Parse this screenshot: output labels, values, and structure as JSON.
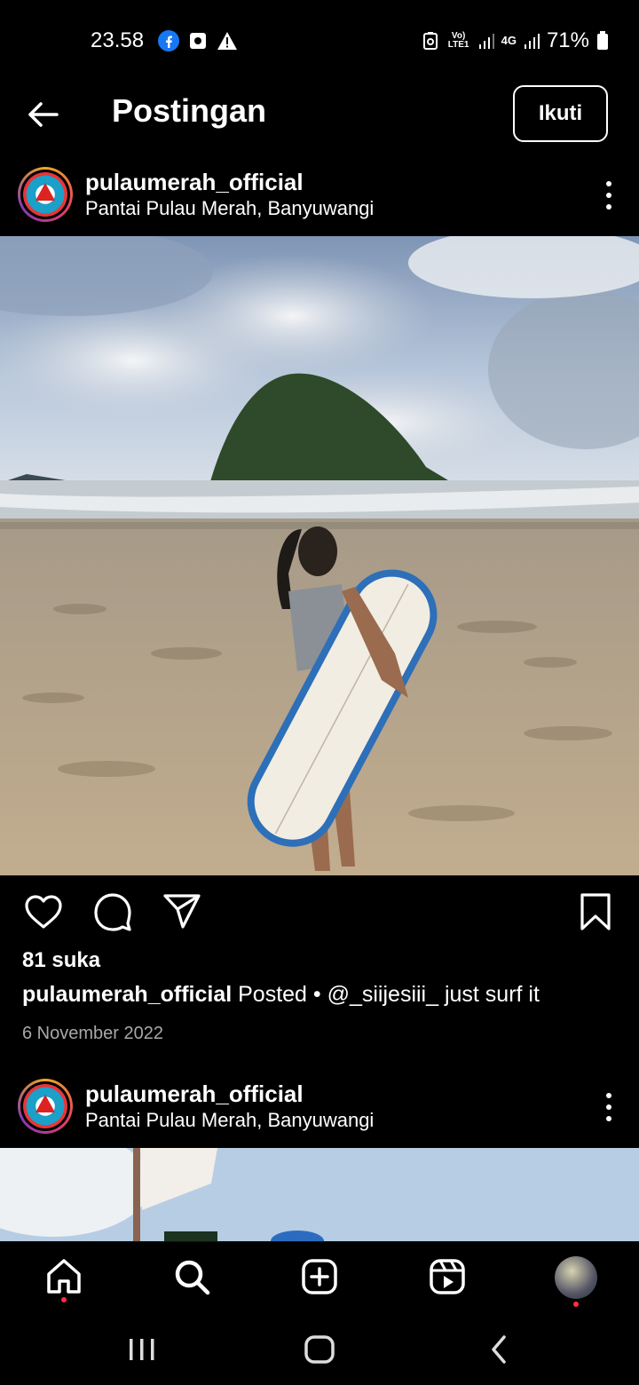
{
  "status_bar": {
    "time": "23.58",
    "battery": "71%",
    "volte_label": "Vo) LTE1",
    "network_label": "4G",
    "icons": [
      "facebook-icon",
      "screenshot-icon",
      "warning-icon",
      "recycle-icon",
      "signal-icon",
      "signal-icon",
      "battery-icon"
    ]
  },
  "header": {
    "title": "Postingan",
    "follow_label": "Ikuti"
  },
  "post": {
    "username": "pulaumerah_official",
    "location": "Pantai Pulau Merah, Banyuwangi",
    "likes": "81 suka",
    "caption_user": "pulaumerah_official",
    "caption_text": " Posted • @_siijesiii_ just surf it",
    "date": "6 November 2022"
  },
  "next_post": {
    "username": "pulaumerah_official",
    "location": "Pantai Pulau Merah, Banyuwangi"
  },
  "bottom_nav": [
    "home-icon",
    "search-icon",
    "add-post-icon",
    "reels-icon",
    "profile-avatar"
  ],
  "system_nav": [
    "recents-button",
    "home-button",
    "back-button"
  ],
  "colors": {
    "background": "#000000",
    "text": "#ffffff",
    "secondary_text": "#a8a8a8",
    "notification_dot": "#ff3040",
    "facebook_blue": "#1877f2"
  }
}
